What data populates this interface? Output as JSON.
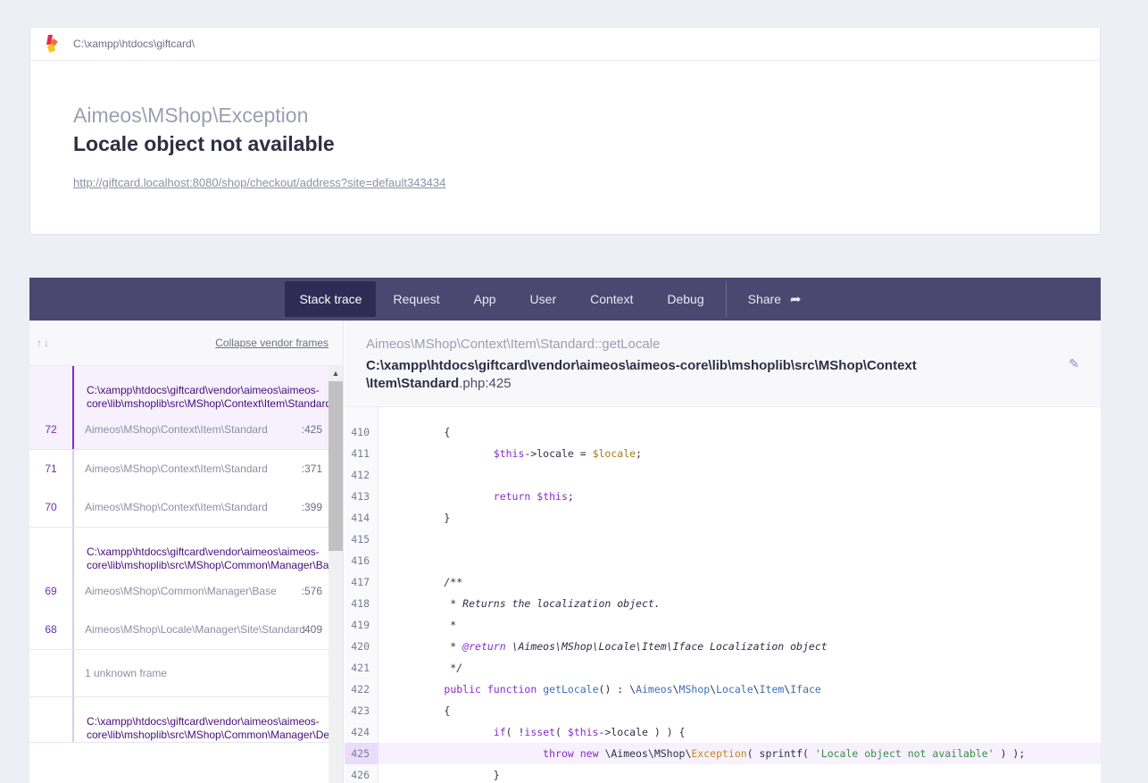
{
  "header": {
    "path": "C:\\xampp\\htdocs\\giftcard\\",
    "exception_class": "Aimeos\\MShop\\Exception",
    "message": "Locale object not available",
    "url": "http://giftcard.localhost:8080/shop/checkout/address?site=default343434"
  },
  "tabs": {
    "stack": "Stack trace",
    "request": "Request",
    "app": "App",
    "user": "User",
    "context": "Context",
    "debug": "Debug",
    "share": "Share"
  },
  "sidebar": {
    "arrows": "↑↓",
    "collapse": "Collapse vendor frames",
    "group1_file": "C:\\xampp\\htdocs\\giftcard\\vendor\\aimeos\\aimeos-core\\lib\\mshoplib\\src\\MShop\\Context\\Item\\Standard.php",
    "frames1": [
      {
        "num": "72",
        "fn": "Aimeos\\MShop\\Context\\Item\\Standard",
        "line": ":425"
      },
      {
        "num": "71",
        "fn": "Aimeos\\MShop\\Context\\Item\\Standard",
        "line": ":371"
      },
      {
        "num": "70",
        "fn": "Aimeos\\MShop\\Context\\Item\\Standard",
        "line": ":399"
      }
    ],
    "group2_file": "C:\\xampp\\htdocs\\giftcard\\vendor\\aimeos\\aimeos-core\\lib\\mshoplib\\src\\MShop\\Common\\Manager\\Base.php",
    "frames2": [
      {
        "num": "69",
        "fn": "Aimeos\\MShop\\Common\\Manager\\Base",
        "line": ":576"
      },
      {
        "num": "68",
        "fn": "Aimeos\\MShop\\Locale\\Manager\\Site\\Standard",
        "line": ":409"
      }
    ],
    "unknown": "1 unknown frame",
    "group3_file": "C:\\xampp\\htdocs\\giftcard\\vendor\\aimeos\\aimeos-core\\lib\\mshoplib\\src\\MShop\\Common\\Manager\\Decorator\\Base.php"
  },
  "detail": {
    "function": "Aimeos\\MShop\\Context\\Item\\Standard::getLocale",
    "file_line1": "C:\\xampp\\htdocs\\giftcard\\vendor\\aimeos\\aimeos-core\\lib\\mshoplib\\src\\MShop\\Context",
    "file_line2": "\\Item\\Standard",
    "file_ext": ".php:425"
  },
  "code": {
    "lines": [
      "410",
      "411",
      "412",
      "413",
      "414",
      "415",
      "416",
      "417",
      "418",
      "419",
      "420",
      "421",
      "422",
      "423",
      "424",
      "425",
      "426"
    ],
    "highlight": "425"
  },
  "colors": {
    "accent": "#7d2ad6",
    "tabbar": "#4b4770"
  }
}
